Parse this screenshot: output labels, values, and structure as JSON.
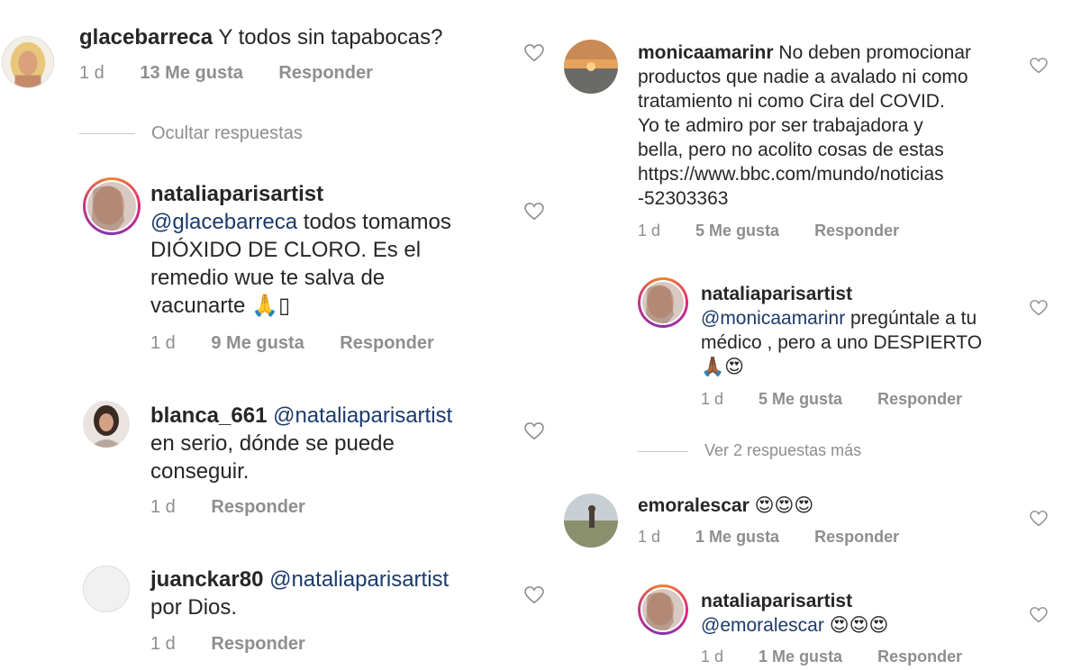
{
  "left": {
    "c1": {
      "user": "glacebarreca",
      "text": "Y todos sin tapabocas?",
      "time": "1 d",
      "likes": "13 Me gusta",
      "reply": "Responder"
    },
    "hide_replies": "Ocultar respuestas",
    "c2": {
      "user": "nataliaparisartist",
      "mention": "@glacebarreca",
      "l1": "todos tomamos",
      "l2": "DIÓXIDO DE CLORO. Es el",
      "l3": "remedio wue te salva de",
      "l4": "vacunarte",
      "emoji": "🙏▯",
      "time": "1 d",
      "likes": "9 Me gusta",
      "reply": "Responder"
    },
    "c3": {
      "user": "blanca_661",
      "mention": "@nataliaparisartist",
      "l2": "en serio, dónde se puede",
      "l3": "conseguir.",
      "time": "1 d",
      "reply": "Responder"
    },
    "c4": {
      "user": "juanckar80",
      "mention": "@nataliaparisartist",
      "l2": "por Dios.",
      "time": "1 d",
      "reply": "Responder"
    }
  },
  "right": {
    "c1": {
      "user": "monicaamarinr",
      "l1": "No deben promocionar",
      "l2": "productos que nadie a avalado ni como",
      "l3": "tratamiento ni como Cira del COVID.",
      "l4": "Yo te admiro por ser trabajadora y",
      "l5": "bella, pero no acolito cosas de estas",
      "l6": "https://www.bbc.com/mundo/noticias",
      "l7": "-52303363",
      "time": "1 d",
      "likes": "5 Me gusta",
      "reply": "Responder"
    },
    "c2": {
      "user": "nataliaparisartist",
      "mention": "@monicaamarinr",
      "l1": "pregúntale a tu",
      "l2": "médico , pero a uno DESPIERTO",
      "emoji": "🙏🏾😍",
      "time": "1 d",
      "likes": "5 Me gusta",
      "reply": "Responder"
    },
    "more_replies": "Ver 2 respuestas más",
    "c3": {
      "user": "emoralescar",
      "emoji": "😍😍😍",
      "time": "1 d",
      "likes": "1 Me gusta",
      "reply": "Responder"
    },
    "c4": {
      "user": "nataliaparisartist",
      "mention": "@emoralescar",
      "emoji": "😍😍😍",
      "time": "1 d",
      "likes": "1 Me gusta",
      "reply": "Responder"
    }
  },
  "colors": {
    "mention": "#1b3a6b",
    "meta": "#8e8e8e",
    "text": "#262626"
  }
}
